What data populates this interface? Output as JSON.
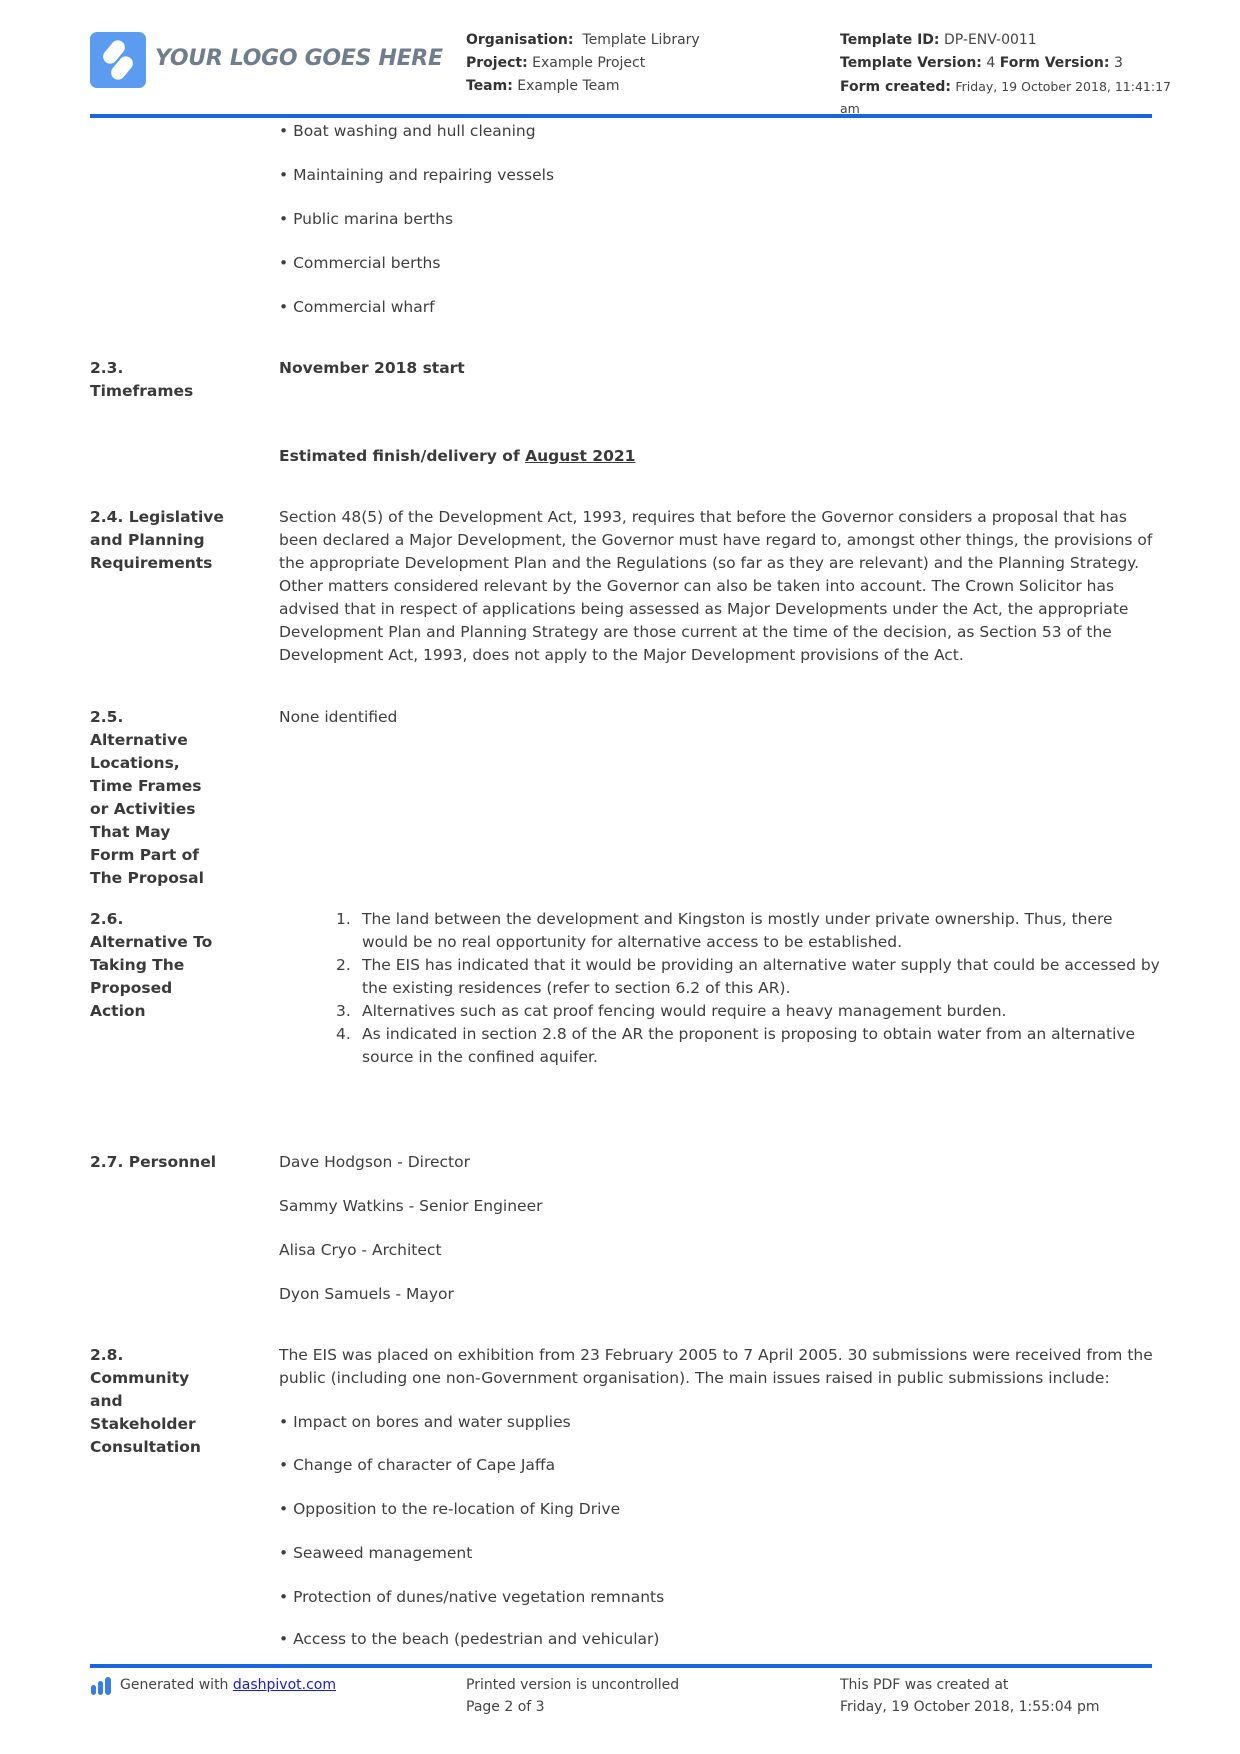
{
  "header": {
    "logo_text": "YOUR LOGO GOES HERE",
    "organisation_label": "Organisation:",
    "organisation_value": "Template Library",
    "project_label": "Project:",
    "project_value": "Example Project",
    "team_label": "Team:",
    "team_value": "Example Team",
    "template_id_label": "Template ID:",
    "template_id_value": "DP-ENV-0011",
    "template_version_label": "Template Version:",
    "template_version_value": "4",
    "form_version_label": "Form Version:",
    "form_version_value": "3",
    "form_created_label": "Form created:",
    "form_created_value": "Friday, 19 October 2018, 11:41:17",
    "form_created_value_cont": "am"
  },
  "top_bullets": [
    "• Boat washing and hull cleaning",
    "• Maintaining and repairing vessels",
    "• Public marina berths",
    "• Commercial berths",
    "• Commercial wharf"
  ],
  "sections": {
    "timeframes": {
      "label_line1": "2.3.",
      "label_line2": "Timeframes",
      "start": "November 2018 start",
      "finish_prefix": "Estimated finish/delivery of ",
      "finish_date": "August 2021"
    },
    "legislative": {
      "label_line1": "2.4. Legislative",
      "label_line2": "and Planning",
      "label_line3": "Requirements",
      "lines": [
        "Section 48(5) of the Development Act, 1993, requires that before the Governor considers a proposal that has",
        "been declared a Major Development, the Governor must have regard to, amongst other things, the provisions of",
        "the appropriate Development Plan and the Regulations (so far as they are relevant) and the Planning Strategy.",
        "Other matters considered relevant by the Governor can also be taken into account. The Crown Solicitor has",
        "advised that in respect of applications being assessed as Major Developments under the Act, the appropriate",
        "Development Plan and Planning Strategy are those current at the time of the decision, as Section 53 of the",
        "Development Act, 1993, does not apply to the Major Development provisions of the Act."
      ]
    },
    "alternatives": {
      "label_lines": [
        "2.5.",
        "Alternative",
        "Locations,",
        "Time Frames",
        "or Activities",
        "That May",
        "Form Part of",
        "The Proposal"
      ],
      "value": "None identified"
    },
    "alternative_action": {
      "label_lines": [
        "2.6.",
        "Alternative To",
        "Taking The",
        "Proposed",
        "Action"
      ],
      "items": [
        {
          "num": "1.",
          "lines": [
            "The land between the development and Kingston is mostly under private ownership. Thus, there",
            "would be no real opportunity for alternative access to be established."
          ]
        },
        {
          "num": "2.",
          "lines": [
            "The EIS has indicated that it would be providing an alternative water supply that could be accessed by",
            "the existing residences (refer to section 6.2 of this AR)."
          ]
        },
        {
          "num": "3.",
          "lines": [
            "Alternatives such as cat proof fencing would require a heavy management burden."
          ]
        },
        {
          "num": "4.",
          "lines": [
            "As indicated in section 2.8 of the AR the proponent is proposing to obtain water from an alternative",
            "source in the confined aquifer."
          ]
        }
      ]
    },
    "personnel": {
      "label": "2.7. Personnel",
      "people": [
        "Dave Hodgson - Director",
        "Sammy Watkins - Senior Engineer",
        "Alisa Cryo - Architect",
        "Dyon Samuels - Mayor"
      ]
    },
    "community": {
      "label_lines": [
        "2.8.",
        "Community",
        "and",
        "Stakeholder",
        "Consultation"
      ],
      "intro_lines": [
        "The EIS was placed on exhibition from 23 February 2005 to 7 April 2005. 30 submissions were received from the",
        "public (including one non-Government organisation). The main issues raised in public submissions include:"
      ],
      "bullets": [
        "• Impact on bores and water supplies",
        "• Change of character of Cape Jaffa",
        "• Opposition to the re-location of King Drive",
        "• Seaweed management",
        "• Protection of dunes/native vegetation remnants",
        "• Access to the beach (pedestrian and vehicular)"
      ]
    }
  },
  "footer": {
    "generated_prefix": "Generated with ",
    "generated_link": "dashpivot.com",
    "uncontrolled": "Printed version is uncontrolled",
    "page": "Page 2 of 3",
    "created_line1": "This PDF was created at",
    "created_line2": "Friday, 19 October 2018, 1:55:04 pm"
  },
  "colors": {
    "accent": "#1a66e0",
    "logo": "#5b9bf0",
    "text": "#3b3b3b",
    "link": "#1a1ad0"
  }
}
